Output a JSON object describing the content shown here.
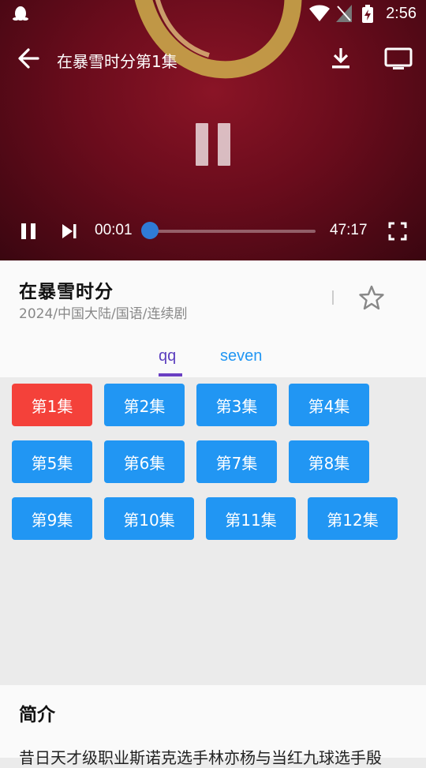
{
  "status_bar": {
    "time": "2:56"
  },
  "player": {
    "title": "在暴雪时分第1集",
    "current_time": "00:01",
    "duration": "47:17",
    "progress": 0.0,
    "accent_color": "#2f7bd6"
  },
  "show": {
    "title": "在暴雪时分",
    "meta": "2024/中国大陆/国语/连续剧",
    "favorite_icon": "star-outline-icon"
  },
  "sources": {
    "tabs": [
      {
        "label": "qq",
        "selected": true
      },
      {
        "label": "seven",
        "selected": false
      }
    ]
  },
  "episodes": {
    "items": [
      {
        "label": "第1集",
        "selected": true
      },
      {
        "label": "第2集"
      },
      {
        "label": "第3集"
      },
      {
        "label": "第4集"
      },
      {
        "label": "第5集"
      },
      {
        "label": "第6集"
      },
      {
        "label": "第7集"
      },
      {
        "label": "第8集"
      },
      {
        "label": "第9集"
      },
      {
        "label": "第10集"
      },
      {
        "label": "第11集"
      },
      {
        "label": "第12集"
      }
    ],
    "colors": {
      "default": "#2196f3",
      "selected": "#f4413a"
    }
  },
  "intro": {
    "title": "简介",
    "text": "昔日天才级职业斯诺克选手林亦杨与当红九球选手殷"
  }
}
